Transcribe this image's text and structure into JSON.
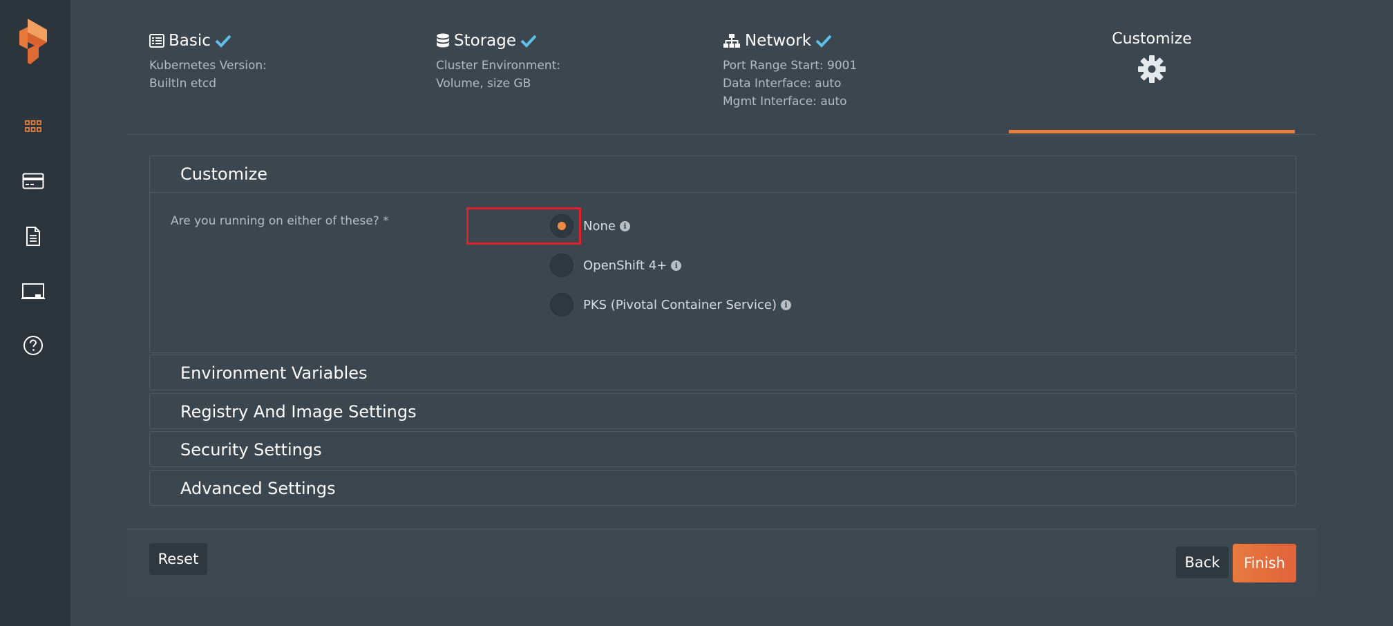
{
  "brand": {
    "accent": "#e47f3e",
    "check_color": "#5fc1ea"
  },
  "sidebar": {
    "items": [
      {
        "name": "apps",
        "icon": "grid-icon"
      },
      {
        "name": "billing",
        "icon": "card-icon"
      },
      {
        "name": "docs",
        "icon": "document-icon"
      },
      {
        "name": "clusters",
        "icon": "monitor-icon"
      },
      {
        "name": "help",
        "icon": "help-circle-icon"
      }
    ]
  },
  "steps": [
    {
      "title": "Basic",
      "icon": "list-icon",
      "completed": true,
      "desc": [
        "Kubernetes Version:",
        "BuiltIn etcd"
      ]
    },
    {
      "title": "Storage",
      "icon": "database-icon",
      "completed": true,
      "desc": [
        "Cluster Environment:",
        "Volume, size GB"
      ]
    },
    {
      "title": "Network",
      "icon": "sitemap-icon",
      "completed": true,
      "desc": [
        "Port Range Start: 9001",
        "Data Interface: auto",
        "Mgmt Interface: auto"
      ]
    },
    {
      "title": "Customize",
      "icon": "gear-icon",
      "active": true
    }
  ],
  "customize": {
    "header": "Customize",
    "question": "Are you running on either of these? *",
    "options": [
      {
        "label": "None",
        "selected": true
      },
      {
        "label": "OpenShift 4+",
        "selected": false
      },
      {
        "label": "PKS (Pivotal Container Service)",
        "selected": false
      }
    ]
  },
  "sections": {
    "env": "Environment Variables",
    "registry": "Registry And Image Settings",
    "security": "Security Settings",
    "advanced": "Advanced Settings"
  },
  "buttons": {
    "reset": "Reset",
    "back": "Back",
    "finish": "Finish"
  }
}
